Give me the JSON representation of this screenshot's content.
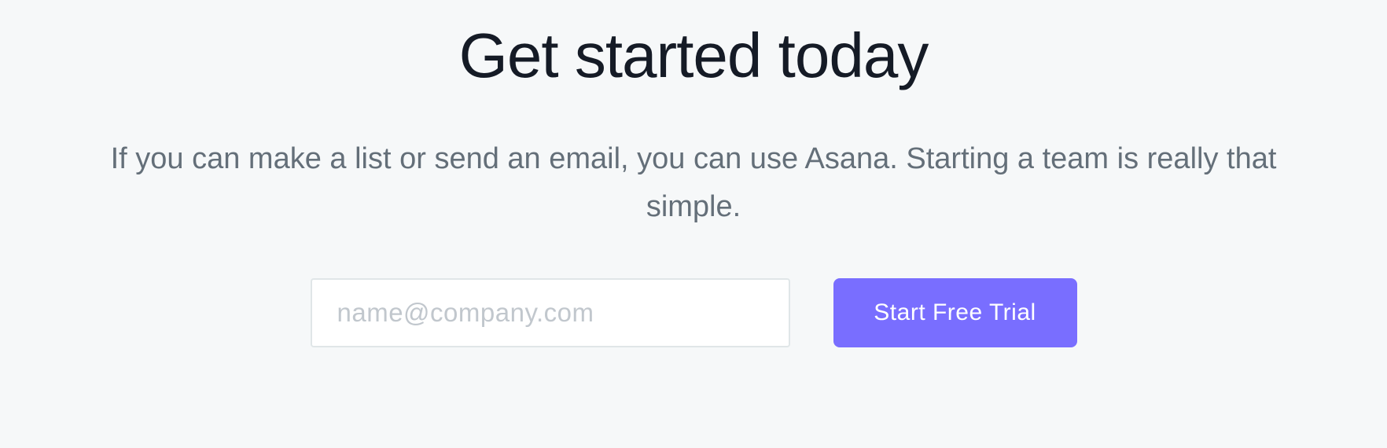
{
  "hero": {
    "heading": "Get started today",
    "subheading": "If you can make a list or send an email, you can use Asana. Starting a team is really that simple."
  },
  "form": {
    "email_placeholder": "name@company.com",
    "cta_label": "Start Free Trial"
  }
}
